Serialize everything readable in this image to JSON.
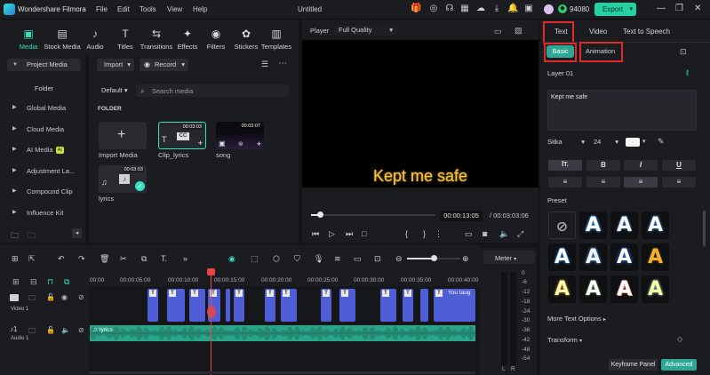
{
  "titlebar": {
    "app_name": "Wondershare Filmora",
    "menu": [
      "File",
      "Edit",
      "Tools",
      "View",
      "Help"
    ],
    "project_title": "Untitled",
    "credits": "94080",
    "export_label": "Export"
  },
  "media_tabs": [
    "Media",
    "Stock Media",
    "Audio",
    "Titles",
    "Transitions",
    "Effects",
    "Filters",
    "Stickers",
    "Templates"
  ],
  "left_nav": {
    "project_media": "Project Media",
    "folder": "Folder",
    "items": [
      "Global Media",
      "Cloud Media",
      "AI Media",
      "Adjustment La...",
      "Compound Clip",
      "Influence Kit"
    ],
    "ai_badge": "AI"
  },
  "media_panel": {
    "import_label": "Import",
    "record_label": "Record",
    "sort_label": "Default",
    "search_placeholder": "Search media",
    "section_label": "FOLDER",
    "items": [
      {
        "name": "Import Media",
        "duration": ""
      },
      {
        "name": "Clip_lyrics",
        "duration": "00:03:03"
      },
      {
        "name": "song",
        "duration": "00:03:07"
      },
      {
        "name": "lyrics",
        "duration": "00:03:03"
      }
    ]
  },
  "player": {
    "label": "Player",
    "quality": "Full Quality",
    "caption": "Kept me safe",
    "current_time": "00:00:13:05",
    "total_time": "/ 00:03:03:06",
    "progress": 0.07
  },
  "right_panel": {
    "tabs": [
      "Text",
      "Video",
      "Text to Speech"
    ],
    "subtabs": [
      "Basic",
      "Animation"
    ],
    "layer": "Layer 01",
    "text_value": "Kept me safe",
    "font": "Sitka",
    "font_size": "24",
    "preset_label": "Preset",
    "more_options": "More Text Options",
    "transform": "Transform",
    "keyframe_label": "Keyframe Panel",
    "advanced_label": "Advanced"
  },
  "timeline": {
    "ticks": [
      "00:00",
      "00:00:05:00",
      "00:00:10:00",
      "00:00:15:00",
      "00:00:20:00",
      "00:00:25:00",
      "00:00:30:00",
      "00:00:35:00",
      "00:00:40:00"
    ],
    "video_track": "Video 1",
    "audio_track": "Audio 1",
    "last_clip_label": "You taug",
    "audio_clip_label": "lyrics"
  },
  "meter": {
    "label": "Meter",
    "scale": [
      "0",
      "-6",
      "-12",
      "-18",
      "-24",
      "-30",
      "-36",
      "-42",
      "-48",
      "-54"
    ],
    "channels": [
      "L",
      "R"
    ]
  },
  "colors": {
    "accent": "#24d1a3",
    "highlight": "#e02a2a",
    "clip": "#4f5dd6",
    "audio": "#2ba58a",
    "caption": "#f0c040"
  }
}
